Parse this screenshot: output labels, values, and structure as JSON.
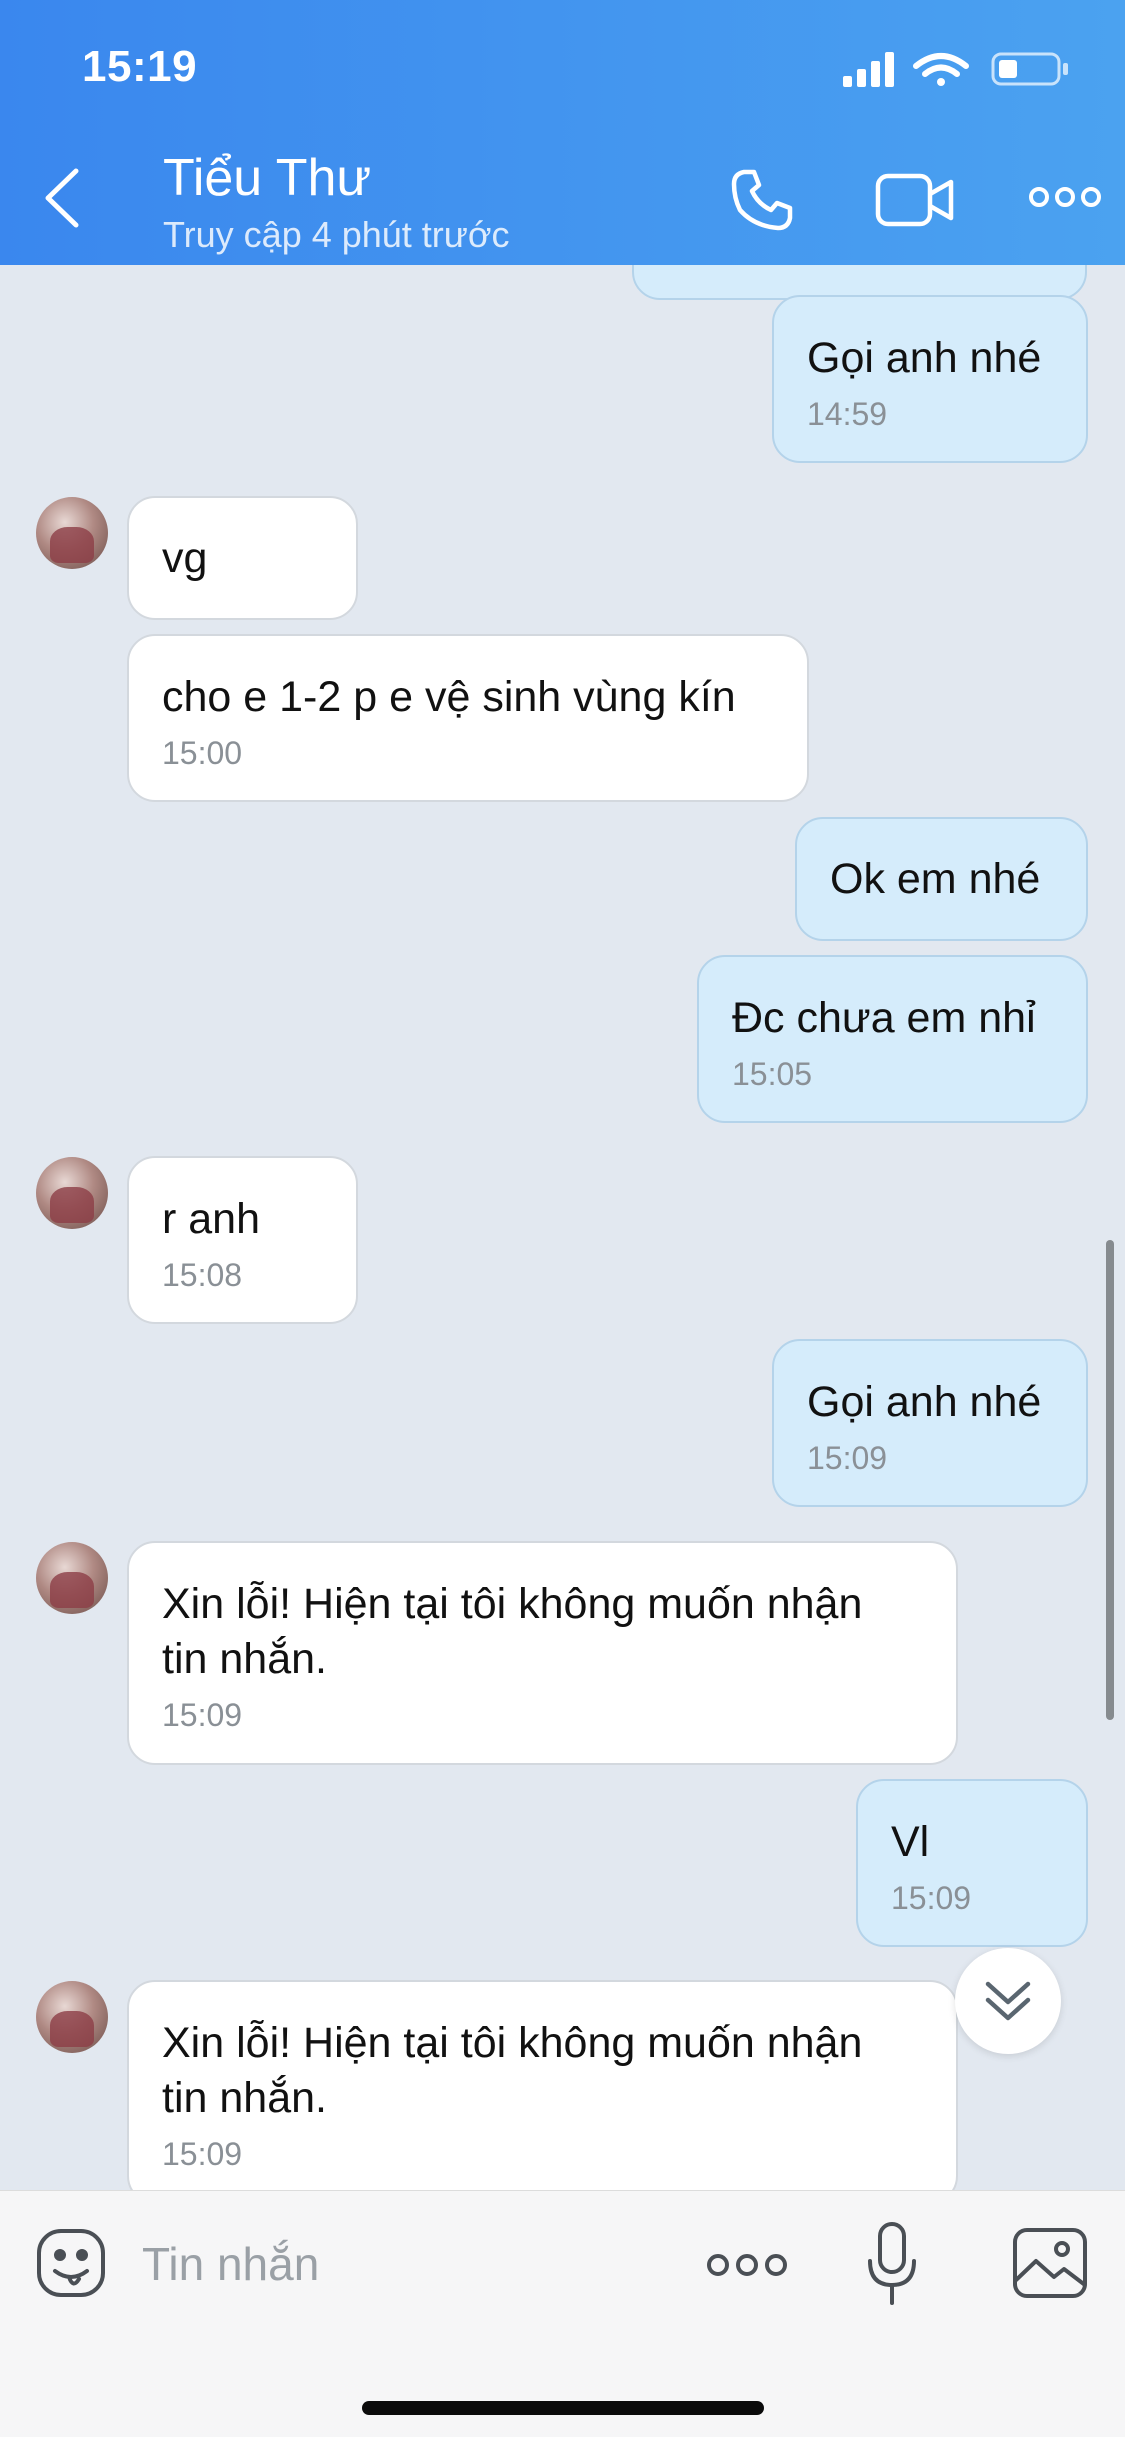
{
  "status_bar": {
    "time": "15:19"
  },
  "header": {
    "contact_name": "Tiểu Thư",
    "last_seen": "Truy cập 4 phút trước"
  },
  "messages": [
    {
      "dir": "out",
      "text": "Gọi anh nhé",
      "time": "14:59"
    },
    {
      "dir": "in",
      "text": "vg",
      "time": ""
    },
    {
      "dir": "in",
      "text": "cho e 1-2 p e vệ sinh vùng kín",
      "time": "15:00"
    },
    {
      "dir": "out",
      "text": "Ok em nhé",
      "time": ""
    },
    {
      "dir": "out",
      "text": "Đc chưa em nhỉ",
      "time": "15:05"
    },
    {
      "dir": "in",
      "text": "r anh",
      "time": "15:08"
    },
    {
      "dir": "out",
      "text": "Gọi anh nhé",
      "time": "15:09"
    },
    {
      "dir": "in",
      "text": "Xin lỗi! Hiện tại tôi không muốn nhận\ntin nhắn.",
      "time": "15:09"
    },
    {
      "dir": "out",
      "text": "Vl",
      "time": "15:09"
    },
    {
      "dir": "in",
      "text": "Xin lỗi! Hiện tại tôi không muốn nhận\ntin nhắn.",
      "time": "15:09"
    }
  ],
  "composer": {
    "placeholder": "Tin nhắn"
  },
  "icons": {
    "back": "chevron-left-icon",
    "call": "phone-icon",
    "video": "video-camera-icon",
    "more": "more-dots-icon",
    "sticker": "emoji-sticker-icon",
    "mic": "microphone-icon",
    "image": "image-icon",
    "scroll_down": "double-chevron-down-icon"
  },
  "colors": {
    "header_gradient_start": "#3a87ee",
    "header_gradient_end": "#4ba2f0",
    "chat_background": "#e2e8f0",
    "incoming_bubble": "#ffffff",
    "outgoing_bubble": "#d5ecfb"
  }
}
